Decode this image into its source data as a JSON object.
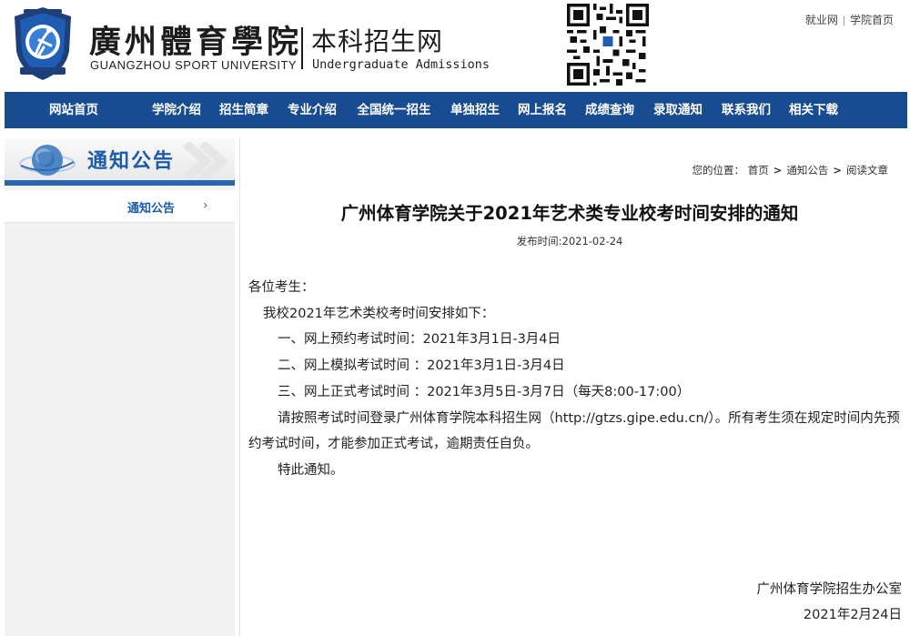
{
  "header": {
    "school_name_cn": "廣州體育學院",
    "school_name_en": "GUANGZHOU SPORT UNIVERSITY",
    "site_name_cn": "本科招生网",
    "site_name_en": "Undergraduate Admissions",
    "top_links": [
      "就业网",
      "学院首页"
    ],
    "top_links_sep": "|"
  },
  "nav": {
    "items": [
      "网站首页",
      "学院介绍",
      "招生简章",
      "专业介绍",
      "全国统一招生",
      "单独招生",
      "网上报名",
      "成绩查询",
      "录取通知",
      "联系我们",
      "相关下载"
    ]
  },
  "sidebar": {
    "title": "通知公告",
    "items": [
      {
        "label": "通知公告"
      }
    ]
  },
  "breadcrumb": {
    "prefix": "您的位置：",
    "items": [
      "首页",
      "通知公告",
      "阅读文章"
    ],
    "sep": ">"
  },
  "article": {
    "title": "广州体育学院关于2021年艺术类专业校考时间安排的通知",
    "pub_time": "发布时间:2021-02-24",
    "salutation": "各位考生：",
    "intro": "我校2021年艺术类校考时间安排如下：",
    "items": [
      "一、网上预约考试时间：2021年3月1日-3月4日",
      "二、网上模拟考试时间 ：2021年3月1日-3月4日",
      "三、网上正式考试时间 ：2021年3月5日-3月7日（每天8:00-17:00）"
    ],
    "instruction": "请按照考试时间登录广州体育学院本科招生网（http://gtzs.gipe.edu.cn/）。所有考生须在规定时间内先预约考试时间，才能参加正式考试，逾期责任自负。",
    "closing": "特此通知。",
    "signer": "广州体育学院招生办公室",
    "sign_date": "2021年2月24日"
  },
  "colors": {
    "nav_bg": "#184b8f",
    "accent_blue": "#1b5ca8",
    "sidebar_bg": "#f3f3f3"
  },
  "icons": [
    "emblem-logo",
    "qr-code",
    "globe-icon",
    "chevron-right-icon"
  ]
}
